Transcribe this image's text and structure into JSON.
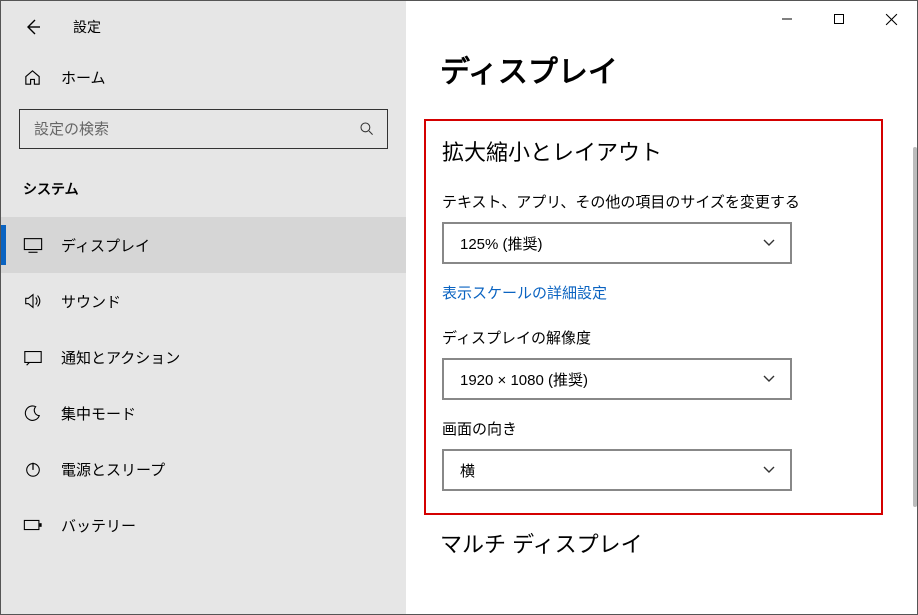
{
  "window": {
    "title": "設定"
  },
  "sidebar": {
    "home_label": "ホーム",
    "search_placeholder": "設定の検索",
    "category": "システム",
    "items": [
      {
        "label": "ディスプレイ",
        "selected": true
      },
      {
        "label": "サウンド",
        "selected": false
      },
      {
        "label": "通知とアクション",
        "selected": false
      },
      {
        "label": "集中モード",
        "selected": false
      },
      {
        "label": "電源とスリープ",
        "selected": false
      },
      {
        "label": "バッテリー",
        "selected": false
      }
    ]
  },
  "main": {
    "page_title": "ディスプレイ",
    "section_title": "拡大縮小とレイアウト",
    "scale_label": "テキスト、アプリ、その他の項目のサイズを変更する",
    "scale_value": "125% (推奨)",
    "advanced_link": "表示スケールの詳細設定",
    "resolution_label": "ディスプレイの解像度",
    "resolution_value": "1920 × 1080 (推奨)",
    "orientation_label": "画面の向き",
    "orientation_value": "横",
    "multi_display_title": "マルチ ディスプレイ"
  }
}
